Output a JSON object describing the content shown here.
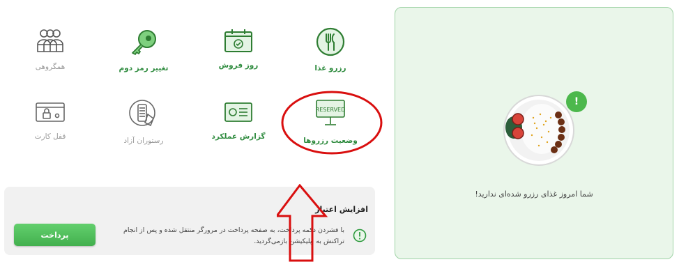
{
  "tiles": {
    "reserve_food": {
      "label": "رزرو غذا",
      "icon": "fork-knife-icon"
    },
    "day_sale": {
      "label": "روز فروش",
      "icon": "calendar-check-icon"
    },
    "change_password": {
      "label": "تغییر رمز دوم",
      "icon": "key-icon"
    },
    "group_members": {
      "label": "همگروهی",
      "icon": "group-icon"
    },
    "reservation_status": {
      "label": "وضعیت رزروها",
      "icon": "reserved-sign-icon",
      "sign_text": "RESERVED"
    },
    "performance_report": {
      "label": "گزارش عملکرد",
      "icon": "report-card-icon"
    },
    "free_restaurant": {
      "label": "رستوران آزاد",
      "icon": "mobile-pay-icon"
    },
    "card_lock": {
      "label": "قفل کارت",
      "icon": "card-lock-icon"
    }
  },
  "empty_state": {
    "text": "شما امروز غذای رزرو شده‌ای ندارید!",
    "badge": "!",
    "icon": "food-plate-icon"
  },
  "credit": {
    "title": "افزایش اعتبار",
    "description": "با فشردن دکمه پرداخت، به صفحه پرداخت در مرورگر منتقل شده و پس از انجام تراکنش به اپلیکیشن بازمی‌گردید.",
    "button_label": "پرداخت",
    "info_icon": "info-icon"
  },
  "colors": {
    "brand_green": "#2e8b3e",
    "panel_bg": "#eaf6ea",
    "panel_border": "#9fd3a6",
    "button_green": "#4cb657",
    "annotation_red": "#d90f0f"
  }
}
